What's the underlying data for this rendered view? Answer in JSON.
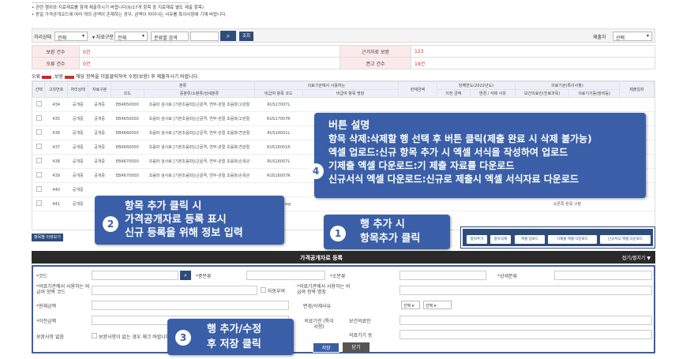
{
  "notes": {
    "line1": "• 관련 행위와 지료재료를 함께 제출하시기 바랍니다(6/17개 항목 중 지료재료 별도 제출 항목)",
    "line2": "• 동일 가격공개코드에 여러 개의 금액이 존재하는 경우, 금액이 차이나는 사유를 특이사항에 기재 바랍니다."
  },
  "filter": {
    "status_label": "처리상태",
    "status_value": "전체",
    "type_label": "자료구분",
    "type_value": "전체",
    "category_value": "분류별 검색",
    "query_label": "조회",
    "year_label": "제출차",
    "year_value": "선택"
  },
  "summary": {
    "supplement_label": "보완 건수",
    "supplement_value": "0건",
    "error_label": "오류 건수",
    "error_value": "0건",
    "basis_label": "근거자료 보완",
    "basis_value": "123",
    "recommend_label": "권고 건수",
    "recommend_value": "19건"
  },
  "legend": {
    "error": "오류",
    "supplement": ",보완",
    "text": "해당 항목을 더블클릭하여 수정(보완) 후 제출하시기 바랍니다."
  },
  "grid": {
    "headers": {
      "select": "선택",
      "no": "고유번호",
      "status": "처리상태",
      "type": "자료구분",
      "category": "분류",
      "code": "코드",
      "sub": "중분류/소분류/상세분류",
      "inst": "의료기관에서 사용하는",
      "inst_code": "비급여 항목 코드",
      "inst_name": "비급여 항목 명칭",
      "amount": "현재금액",
      "current": "당해연도(2022년도)",
      "prev": "이전 금액",
      "change": "변경 / 삭제 사유",
      "device": "의료기관(특이사항)",
      "dev_name": "보건의료인(진료과목)",
      "dev2": "의료기기등(장비등)",
      "date": "제출일자"
    },
    "rows": [
      {
        "no": "434",
        "status": "공개중",
        "type": "공개중",
        "code": "EB4650000",
        "name": "초음파 검사료 [기본초음파](근골격, 연부-관절 초음파/고관절",
        "inst": "RUS17007L"
      },
      {
        "no": "435",
        "status": "공개중",
        "type": "공개중",
        "code": "EB4650000",
        "name": "초음파 검사료 [기본초음파](근골격, 연부-관절 초음파/고관절",
        "inst": "RUS17007R"
      },
      {
        "no": "436",
        "status": "공개중",
        "type": "공개중",
        "code": "EB4660000",
        "name": "초음파 검사료 [기본초음파](근골격, 연부-관절 초음파/견관절",
        "inst": "RUS16001L"
      },
      {
        "no": "437",
        "status": "공개중",
        "type": "공개중",
        "code": "EB4660000",
        "name": "초음파 검사료 [기본초음파](근골격, 연부-관절 초음파/견관절",
        "inst": "RUS16001R"
      },
      {
        "no": "438",
        "status": "공개중",
        "type": "공개중",
        "code": "EB4670000",
        "name": "초음파 검사료 [기본초음파](근골격, 연부-관절 초음파/손목관",
        "inst": "RUS16007L"
      },
      {
        "no": "439",
        "status": "공개중",
        "type": "공개중",
        "code": "EB4670000",
        "name": "초음파 검사료 [기본초음파](근골격, 연부-관절 초음파/손목관",
        "inst": "RUS16007R"
      },
      {
        "no": "440",
        "status": "공개중",
        "type": "",
        "code": "",
        "name": "",
        "inst": ""
      },
      {
        "no": "441",
        "status": "공개중",
        "type": "",
        "code": "",
        "name": "",
        "inst": "Ankle sonog"
      }
    ],
    "extra": "오른쪽 원목 구분"
  },
  "link_btn": "항목별 이력보기",
  "buttons": {
    "add": "항목추가",
    "delete": "항목삭제",
    "upload": "엑셀 업로드",
    "dl_submitted": "기제출 엑셀 다운로드",
    "dl_new": "신규서식 엑셀 다운로드"
  },
  "panel": {
    "title": "가격공개자료 등록",
    "toggle": "접기/펼치기"
  },
  "form": {
    "code": "코드",
    "mid": "중분류",
    "small": "소분류",
    "detail": "상세분류",
    "inst_code": "의료기관에서 사용하는 비급여 항목 코드",
    "self_check": "자동부여",
    "inst_name": "의료기관에서 사용하는 비급여 항목 명칭",
    "amount": "현재금액",
    "reason": "변경/삭제사유",
    "sel1": "선택",
    "sel2": "선택",
    "prev": "이전금액",
    "inst_special": "의료기관 (특이사항)",
    "health": "보건의료인",
    "device": "의료기기 등",
    "supp_label": "보완사항 없음",
    "supp_check": "보완사항이 없는 경우 체크 바랍니다.",
    "save": "저장",
    "close": "닫기"
  },
  "callouts": {
    "c1_num": "1",
    "c1_l1": "행 추가 시",
    "c1_l2": "항목추가 클릭",
    "c2_num": "2",
    "c2_l1": "항목 추가 클릭 시",
    "c2_l2": "가격공개자료 등록 표시",
    "c2_l3": "신규 등록을 위해 정보 입력",
    "c3_num": "3",
    "c3_l1": "행 추가/수정",
    "c3_l2": "후 저장 클릭",
    "c4_num": "4",
    "c4_l1": "버튼 설명",
    "c4_l2": "항목 삭제:삭제할 행 선택 후 버튼 클릭(제출 완료 시 삭제 불가능)",
    "c4_l3": "엑셀 업로드:신규 항목 추가 시 엑셀 서식을 작성하여 업로드",
    "c4_l4": "기제출 엑셀 다운로드:기 제출 자료를 다운로드",
    "c4_l5": "신규서식 엑셀 다운로드:신규로 제출시 엑셀 서식자료 다운로드"
  }
}
